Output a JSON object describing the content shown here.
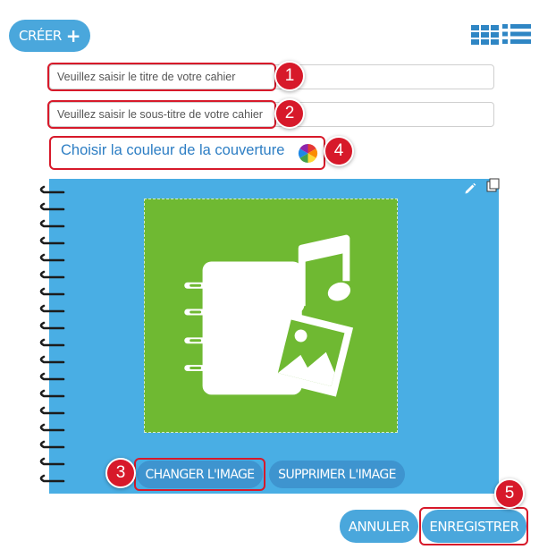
{
  "header": {
    "create_label": "CRÉER",
    "create_icon": "plus-icon",
    "view_icons": [
      "grid-view-icon",
      "list-view-icon"
    ]
  },
  "form": {
    "title_placeholder": "Veuillez saisir le titre de votre cahier",
    "subtitle_placeholder": "Veuillez saisir le sous-titre de votre cahier",
    "cover_color_label": "Choisir la couleur de la couverture"
  },
  "cover": {
    "background_color": "#49aee4",
    "image_background_color": "#6fb932",
    "image_icon": "notebook-music-image-icon",
    "change_image_label": "CHANGER L'IMAGE",
    "delete_image_label": "SUPPRIMER L'IMAGE",
    "tool_icons": [
      "pencil-icon",
      "copy-icon"
    ]
  },
  "footer": {
    "cancel_label": "ANNULER",
    "save_label": "ENREGISTRER"
  },
  "annotations": {
    "color": "#d7192a",
    "badges": [
      "1",
      "2",
      "3",
      "4",
      "5"
    ]
  },
  "colors": {
    "accent": "#4aa7dc",
    "link": "#2d7ec4"
  }
}
